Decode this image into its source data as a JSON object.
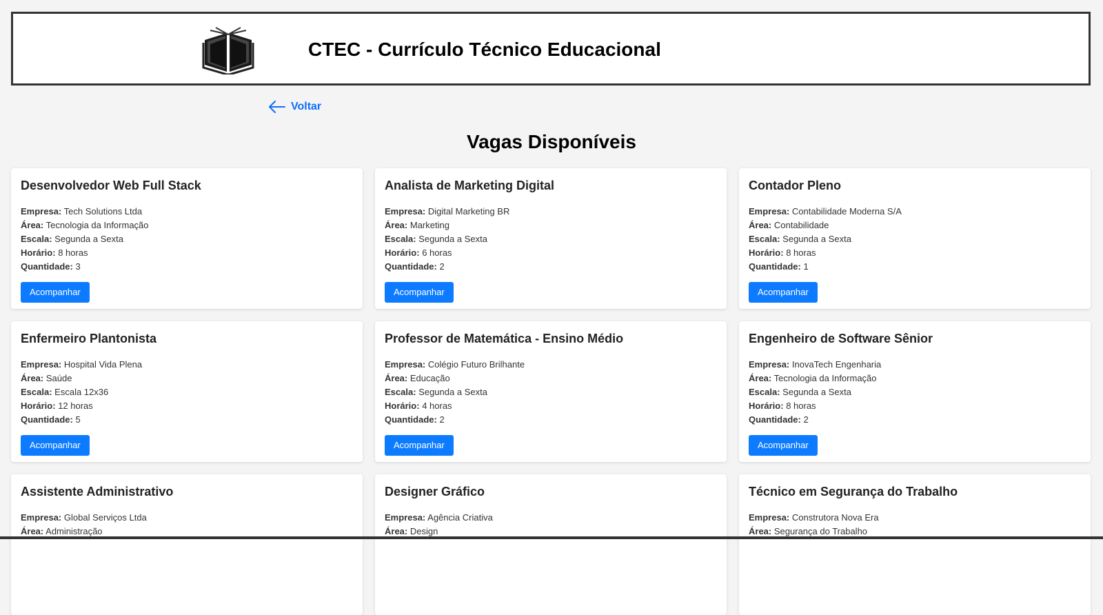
{
  "header": {
    "title": "CTEC - Currículo Técnico Educacional",
    "logo_icon": "open-book-icon"
  },
  "nav": {
    "back_label": "Voltar",
    "back_icon": "arrow-left-icon"
  },
  "main": {
    "title": "Vagas Disponíveis"
  },
  "labels": {
    "empresa": "Empresa:",
    "area": "Área:",
    "escala": "Escala:",
    "horario": "Horário:",
    "quantidade": "Quantidade:",
    "button": "Acompanhar"
  },
  "jobs": [
    {
      "title": "Desenvolvedor Web Full Stack",
      "empresa": "Tech Solutions Ltda",
      "area": "Tecnologia da Informação",
      "escala": "Segunda a Sexta",
      "horario": "8 horas",
      "quantidade": "3"
    },
    {
      "title": "Analista de Marketing Digital",
      "empresa": "Digital Marketing BR",
      "area": "Marketing",
      "escala": "Segunda a Sexta",
      "horario": "6 horas",
      "quantidade": "2"
    },
    {
      "title": "Contador Pleno",
      "empresa": "Contabilidade Moderna S/A",
      "area": "Contabilidade",
      "escala": "Segunda a Sexta",
      "horario": "8 horas",
      "quantidade": "1"
    },
    {
      "title": "Enfermeiro Plantonista",
      "empresa": "Hospital Vida Plena",
      "area": "Saúde",
      "escala": "Escala 12x36",
      "horario": "12 horas",
      "quantidade": "5"
    },
    {
      "title": "Professor de Matemática - Ensino Médio",
      "empresa": "Colégio Futuro Brilhante",
      "area": "Educação",
      "escala": "Segunda a Sexta",
      "horario": "4 horas",
      "quantidade": "2"
    },
    {
      "title": "Engenheiro de Software Sênior",
      "empresa": "InovaTech Engenharia",
      "area": "Tecnologia da Informação",
      "escala": "Segunda a Sexta",
      "horario": "8 horas",
      "quantidade": "2"
    },
    {
      "title": "Assistente Administrativo",
      "empresa": "Global Serviços Ltda",
      "area": "Administração"
    },
    {
      "title": "Designer Gráfico",
      "empresa": "Agência Criativa",
      "area": "Design"
    },
    {
      "title": "Técnico em Segurança do Trabalho",
      "empresa": "Construtora Nova Era",
      "area": "Segurança do Trabalho"
    }
  ]
}
